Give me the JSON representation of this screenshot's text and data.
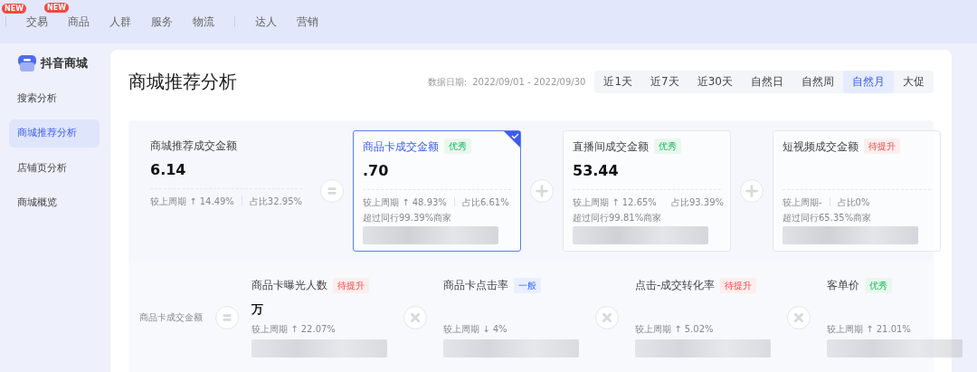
{
  "nav": {
    "edge_badge": "NEW",
    "items": [
      {
        "label": "交易",
        "badge": "NEW",
        "divider_before": true,
        "divider_after": false
      },
      {
        "label": "商品",
        "divider_before": false,
        "divider_after": false
      },
      {
        "label": "人群",
        "divider_before": false,
        "divider_after": false
      },
      {
        "label": "服务",
        "divider_before": false,
        "divider_after": false
      },
      {
        "label": "物流",
        "divider_before": false,
        "divider_after": true
      },
      {
        "label": "达人",
        "divider_before": false,
        "divider_after": false
      },
      {
        "label": "营销",
        "divider_before": false,
        "divider_after": false
      }
    ]
  },
  "sidebar": {
    "brand": "抖音商城",
    "items": [
      {
        "label": "搜索分析",
        "selected": false
      },
      {
        "label": "商城推荐分析",
        "selected": true
      },
      {
        "label": "店铺页分析",
        "selected": false
      },
      {
        "label": "商城概览",
        "selected": false
      }
    ]
  },
  "page": {
    "title": "商城推荐分析",
    "date_label": "数据日期:",
    "date_range": "2022/09/01 - 2022/09/30"
  },
  "tabs": [
    {
      "label": "近1天",
      "selected": false
    },
    {
      "label": "近7天",
      "selected": false
    },
    {
      "label": "近30天",
      "selected": false
    },
    {
      "label": "自然日",
      "selected": false
    },
    {
      "label": "自然周",
      "selected": false
    },
    {
      "label": "自然月",
      "selected": true
    },
    {
      "label": "大促",
      "selected": false
    }
  ],
  "top_metrics": [
    {
      "kind": "total",
      "title": "商城推荐成交金额",
      "value": "6.14",
      "compare": "较上周期 ↑ 14.49%",
      "share": "占比32.95%",
      "selected": false,
      "operator": {
        "kind": "equals"
      }
    },
    {
      "kind": "card",
      "title": "商品卡成交金额",
      "tag": {
        "label": "优秀",
        "kind": "good"
      },
      "value": ".70",
      "compare": "较上周期 ↑ 48.93%",
      "share": "占比6.61%",
      "beat": "超过同行99.39%商家",
      "selected": true,
      "operator": {
        "kind": "plus"
      }
    },
    {
      "kind": "card",
      "title": "直播间成交金额",
      "tag": {
        "label": "优秀",
        "kind": "good"
      },
      "value": "53.44",
      "compare": "较上周期 ↑ 12.65%",
      "share": "占比93.39%",
      "beat": "超过同行99.81%商家",
      "selected": false,
      "operator": {
        "kind": "plus"
      }
    },
    {
      "kind": "card",
      "title": "短视频成交金额",
      "tag": {
        "label": "待提升",
        "kind": "bad"
      },
      "compare": "较上周期-",
      "share": "占比0%",
      "beat": "超过同行65.35%商家",
      "selected": false
    }
  ],
  "breakdown": {
    "label": "商品卡成交金额",
    "operator": {
      "kind": "equals"
    },
    "metrics": [
      {
        "title": "商品卡曝光人数",
        "tag": {
          "label": "待提升",
          "kind": "bad"
        },
        "value": "万",
        "compare": "较上周期 ↑ 22.07%"
      },
      {
        "title": "商品卡点击率",
        "tag": {
          "label": "一般",
          "kind": "mid"
        },
        "compare": "较上周期 ↓ 4%",
        "operator": {
          "kind": "times"
        }
      },
      {
        "title": "点击-成交转化率",
        "tag": {
          "label": "待提升",
          "kind": "bad"
        },
        "compare": "较上周期 ↑ 5.02%",
        "operator": {
          "kind": "times"
        }
      },
      {
        "title": "客单价",
        "tag": {
          "label": "优秀",
          "kind": "good"
        },
        "compare": "较上周期 ↑ 21.01%",
        "operator": {
          "kind": "times"
        }
      }
    ]
  }
}
